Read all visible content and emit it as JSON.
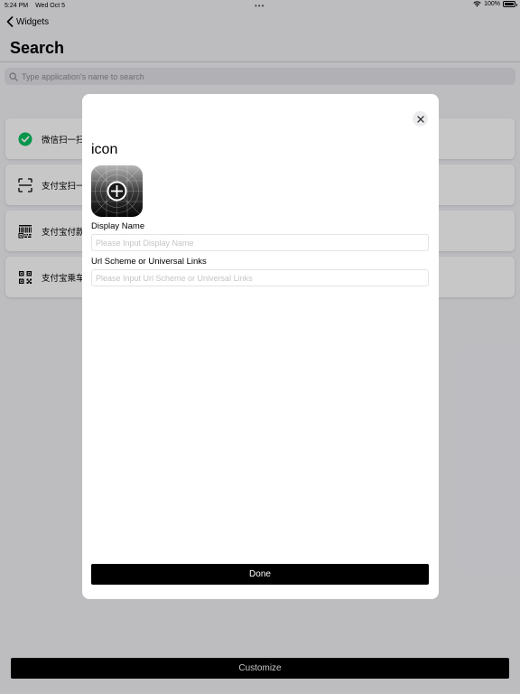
{
  "status_bar": {
    "time": "5:24 PM",
    "date": "Wed Oct 5",
    "battery": "100%"
  },
  "nav": {
    "back_label": "Widgets",
    "title": "Search"
  },
  "search": {
    "placeholder": "Type application's name to search"
  },
  "apps": [
    {
      "label": "微信扫一扫",
      "icon": "wechat-check-icon"
    },
    {
      "label": "支付宝扫一扫",
      "icon": "scan-frame-icon"
    },
    {
      "label": "支付宝付款码",
      "icon": "barcode-icon"
    },
    {
      "label": "支付宝乘车码",
      "icon": "qr-code-icon"
    }
  ],
  "customize_label": "Customize",
  "modal": {
    "heading": "icon",
    "display_name_label": "Display Name",
    "display_name_placeholder": "Please Input Display Name",
    "url_label": "Url Scheme or Universal Links",
    "url_placeholder": "Please Input Url Scheme or Universal Links",
    "done_label": "Done"
  },
  "colors": {
    "wechat_green": "#07c160",
    "background": "#f2f2f7",
    "button": "#000000"
  }
}
